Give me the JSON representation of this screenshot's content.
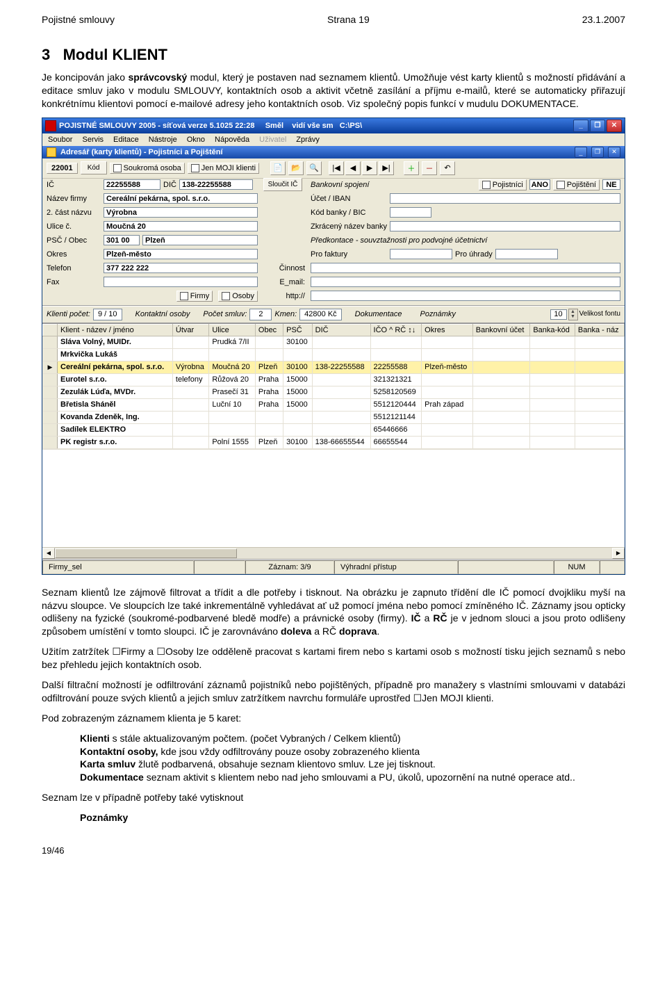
{
  "header": {
    "left": "Pojistné smlouvy",
    "center": "Strana 19",
    "right": "23.1.2007"
  },
  "heading_num": "3",
  "heading": "Modul KLIENT",
  "intro_para": "Je koncipován jako správcovský modul, který je postaven nad seznamem klientů. Umožňuje vést karty klientů s možností přidávání a editace smluv jako v modulu SMLOUVY, kontaktních osob a aktivit včetně zasílání a příjmu e-mailů, které se automaticky přiřazují konkrétnímu klientovi pomocí e-mailové adresy jeho kontaktních osob. Viz společný popis funkcí v mudulu DOKUMENTACE.",
  "intro_bold_word": "správcovský",
  "app": {
    "title_a": "POJISTNÉ SMLOUVY 2005 - síťová verze 5.1025 22:28",
    "title_b": "Směl",
    "title_c": "vidí vše sm",
    "title_d": "C:\\PS\\",
    "menu": [
      "Soubor",
      "Servis",
      "Editace",
      "Nástroje",
      "Okno",
      "Nápověda",
      "Uživatel",
      "Zprávy"
    ],
    "menu_disabled_index": 6,
    "doc_title": "Adresář (karty klientů)  -  Pojistníci a Pojištění",
    "toolbar": {
      "num": "22001",
      "kod": "Kód",
      "chk_soukroma": "Soukromá osoba",
      "chk_moji": "Jen MOJI klienti"
    },
    "form": {
      "ic_lbl": "IČ",
      "ic": "22255588",
      "dic_lbl": "DIČ",
      "dic": "138-22255588",
      "sloucit": "Sloučit IČ",
      "bank_spoj": "Bankovní spojení",
      "pojistnici": "Pojistníci",
      "pojistnici_val": "ANO",
      "pojisteni": "Pojištění",
      "pojisteni_val": "NE",
      "nazev_lbl": "Název firmy",
      "nazev": "Cereální pekárna, spol. s.r.o.",
      "ucet": "Účet / IBAN",
      "cast2_lbl": "2. část názvu",
      "cast2": "Výrobna",
      "kodbanky": "Kód banky / BIC",
      "ulice_lbl": "Ulice č.",
      "ulice": "Moučná 20",
      "zkraz": "Zkrácený název banky",
      "psc_lbl": "PSČ / Obec",
      "psc": "301 00",
      "obec": "Plzeň",
      "predk": "Předkontace - souvztažnosti pro podvojné účetnictví",
      "okres_lbl": "Okres",
      "okres": "Plzeň-město",
      "faktury": "Pro faktury",
      "uhrady": "Pro úhrady",
      "tel_lbl": "Telefon",
      "tel": "377 222 222",
      "cinnost": "Činnost",
      "fax_lbl": "Fax",
      "email": "E_mail:",
      "firmy": "Firmy",
      "osoby": "Osoby",
      "http": "http://"
    },
    "tabs": {
      "klienti_pocet_lbl": "Klienti počet:",
      "klienti_pocet": "9 / 10",
      "kontaktni": "Kontaktní osoby",
      "pocet_smluv_lbl": "Počet smluv:",
      "pocet_smluv": "2",
      "kmen_lbl": "Kmen:",
      "kmen": "42800 Kč",
      "dokumentace": "Dokumentace",
      "poznamky": "Poznámky",
      "font_val": "10",
      "font_lbl": "Velikost fontu"
    },
    "grid": {
      "cols": [
        "Klient - název / jméno",
        "Útvar",
        "Ulice",
        "Obec",
        "PSČ",
        "DIČ",
        "IČO ^ RČ ↕↓",
        "Okres",
        "Bankovní účet",
        "Banka-kód",
        "Banka - náz"
      ],
      "rows": [
        {
          "c": [
            "Sláva Volný, MUIDr.",
            "",
            "Prudká 7/II",
            "",
            "30100",
            "",
            "",
            "",
            "",
            "",
            ""
          ]
        },
        {
          "c": [
            "Mrkvička Lukáš",
            "",
            "",
            "",
            "",
            "",
            "",
            "",
            "",
            "",
            ""
          ]
        },
        {
          "sel": true,
          "mark": "▶",
          "c": [
            "Cereální pekárna, spol. s.r.o.",
            "Výrobna",
            "Moučná 20",
            "Plzeň",
            "30100",
            "138-22255588",
            "22255588",
            "Plzeň-město",
            "",
            "",
            ""
          ]
        },
        {
          "c": [
            "Eurotel s.r.o.",
            "telefony",
            "Růžová 20",
            "Praha",
            "15000",
            "",
            "321321321",
            "",
            "",
            "",
            ""
          ]
        },
        {
          "c": [
            "Zezulák Lúďa, MVDr.",
            "",
            "Prasečí 31",
            "Praha",
            "15000",
            "",
            "5258120569",
            "",
            "",
            "",
            ""
          ]
        },
        {
          "c": [
            "Břetisla Sháněl",
            "",
            "Luční 10",
            "Praha",
            "15000",
            "",
            "5512120444",
            "Prah západ",
            "",
            "",
            ""
          ]
        },
        {
          "c": [
            "Kovanda Zdeněk, Ing.",
            "",
            "",
            "",
            "",
            "",
            "5512121144",
            "",
            "",
            "",
            ""
          ]
        },
        {
          "c": [
            "Sadílek ELEKTRO",
            "",
            "",
            "",
            "",
            "",
            "65446666",
            "",
            "",
            "",
            ""
          ]
        },
        {
          "c": [
            "PK registr s.r.o.",
            "",
            "Polní 1555",
            "Plzeň",
            "30100",
            "138-66655544",
            "66655544",
            "",
            "",
            "",
            ""
          ]
        }
      ]
    },
    "status": {
      "left": "Firmy_sel",
      "zaznam": "Záznam: 3/9",
      "vyhr": "Výhradní přístup",
      "num": "NUM"
    }
  },
  "para2_parts": [
    "Seznam klientů lze zájmově filtrovat a třídit a dle potřeby i tisknout. Na obrázku je zapnuto třídění dle IČ pomocí dvojkliku myší na názvu sloupce. Ve sloupcích lze také inkrementálně vyhledávat ať už pomocí jména nebo pomocí zmíněného IČ. Záznamy jsou opticky odlišeny na fyzické (soukromé-podbarvené bledě modře) a právnické osoby (firmy). ",
    "IČ",
    " a ",
    "RČ",
    " je v jednom slouci a jsou proto odlišeny způsobem umístění v tomto sloupci. IČ je zarovnáváno ",
    "doleva",
    " a RČ ",
    "doprava",
    "."
  ],
  "para3": "Užitím zatržítek ☐Firmy a ☐Osoby lze odděleně pracovat s kartami firem nebo s kartami osob s možností tisku jejich seznamů s nebo bez přehledu jejich kontaktních osob.",
  "para4": "Další filtrační možností je odfiltrování záznamů pojistníků nebo pojištěných, případně pro manažery s vlastními smlouvami v databázi odfiltrování pouze svých klientů a jejich smluv zatržítkem navrchu formuláře uprostřed ☐Jen MOJI klienti.",
  "para5_intro": "Pod zobrazeným záznamem klienta je 5 karet:",
  "cards": [
    {
      "b": "Klienti",
      "t": " s stále aktualizovaným počtem. (počet Vybraných / Celkem klientů)"
    },
    {
      "b": "Kontaktní osoby,",
      "t": " kde jsou vždy odfiltrovány pouze osoby zobrazeného klienta"
    },
    {
      "b": "Karta smluv",
      "t": " žlutě podbarvená, obsahuje seznam klientovo smluv. Lze jej tisknout."
    },
    {
      "b": "Dokumentace",
      "t": " seznam aktivit s klientem nebo nad jeho smlouvami a PU, úkolů, upozornění na nutné operace atd.."
    }
  ],
  "para6": "Seznam lze v případně potřeby také vytisknout",
  "poznamky_b": "Poznámky",
  "footer": "19/46"
}
